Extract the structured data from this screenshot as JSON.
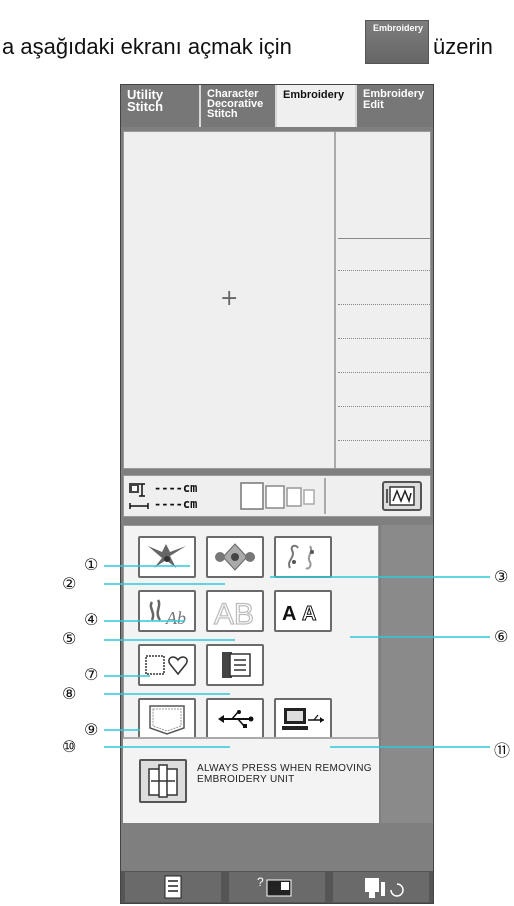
{
  "caption": {
    "text_before": "a aşağıdaki ekranı açmak için",
    "key_label": "Embroidery",
    "text_after": "üzerin"
  },
  "tabs": [
    {
      "label": "Utility\nStitch"
    },
    {
      "label": "Character\nDecorative\nStitch"
    },
    {
      "label": "Embroidery"
    },
    {
      "label": "Embroidery\nEdit"
    }
  ],
  "preview": {
    "center_mark": "+"
  },
  "dimensions": {
    "height_text": "----cm",
    "width_text": "----cm"
  },
  "categories": [
    {
      "number": "①",
      "icon": "bird-pattern-icon"
    },
    {
      "number": "②",
      "icon": "floral-pattern-icon"
    },
    {
      "number": "③",
      "icon": "border-pattern-icon"
    },
    {
      "number": "④",
      "icon": "floral-alphabet-icon"
    },
    {
      "number": "⑤",
      "icon": "letters-ab-icon"
    },
    {
      "number": "⑥",
      "icon": "letters-aa-icon"
    },
    {
      "number": "⑦",
      "icon": "frame-shapes-icon"
    },
    {
      "number": "⑧",
      "icon": "embroidery-card-icon"
    },
    {
      "number": "⑨",
      "icon": "pocket-memory-icon"
    },
    {
      "number": "⑩",
      "icon": "usb-icon"
    },
    {
      "number": "⑪",
      "icon": "computer-usb-icon"
    }
  ],
  "remove_note": "ALWAYS PRESS WHEN REMOVING EMBROIDERY UNIT",
  "colors": {
    "screen_gray": "#7f7f7f",
    "callout_line": "#2ec9d8"
  }
}
